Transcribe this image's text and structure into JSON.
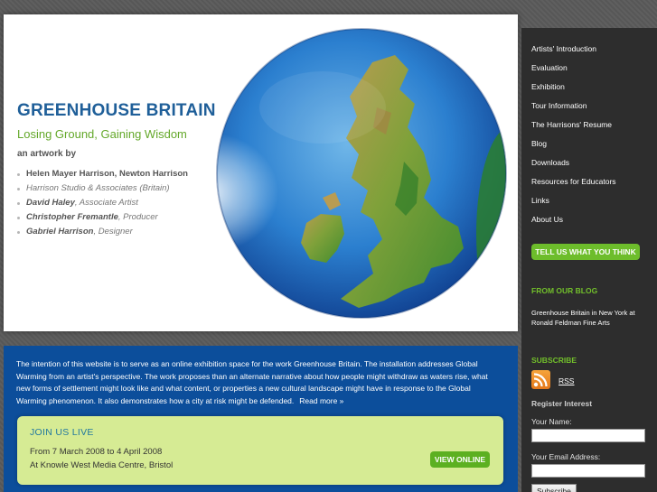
{
  "hero": {
    "title": "GREENHOUSE BRITAIN",
    "subtitle": "Losing Ground, Gaining Wisdom",
    "byline": "an artwork by",
    "credits": {
      "artists": "Helen Mayer Harrison, Newton Harrison",
      "studio": "Harrison Studio & Associates (Britain)",
      "haley_name": "David Haley",
      "haley_role": ", Associate Artist",
      "fremantle_name": "Christopher Fremantle",
      "fremantle_role": ", Producer",
      "harrison_name": "Gabriel Harrison",
      "harrison_role": ", Designer"
    }
  },
  "sidebar": {
    "nav": [
      "Artists' Introduction",
      "Evaluation",
      "Exhibition",
      "Tour Information",
      "The Harrisons' Resume",
      "Blog",
      "Downloads",
      "Resources for Educators",
      "Links",
      "About Us"
    ],
    "cta": "TELL US WHAT YOU THINK",
    "blog_heading": "FROM OUR BLOG",
    "blog_post": "Greenhouse Britain in New York at Ronald Feldman Fine Arts",
    "subscribe_heading": "SUBSCRIBE",
    "rss_label": "RSS",
    "register_heading": "Register Interest",
    "name_label": "Your Name:",
    "name_value": "",
    "email_label": "Your Email Address:",
    "email_value": "",
    "subscribe_button": "Subscribe"
  },
  "content": {
    "intro": "The intention of this website is to serve as an online exhibition space for the work Greenhouse Britain. The installation addresses Global Warming from an artist's perspective. The work proposes than an alternate narrative about how people might withdraw as waters rise, what new forms of settlement might look like and what content, or properties a new cultural landscape might have in response to the Global Warming phenomenon. It also demonstrates how a city at risk might be defended.",
    "read_more": "Read more »"
  },
  "live": {
    "title": "JOIN US LIVE",
    "dates": "From 7 March 2008 to 4 April 2008",
    "venue": "At Knowle West Media Centre, Bristol",
    "button": "VIEW ONLINE"
  },
  "colors": {
    "title_blue": "#1f5f99",
    "subtitle_green": "#64a82a",
    "content_blue": "#0c4e9b",
    "sidebar_dark": "#2d2d2d",
    "accent_green": "#6dbd2b",
    "live_box": "#d6eb94"
  },
  "icons": {
    "globe": "globe-map-image",
    "rss": "rss-icon"
  }
}
